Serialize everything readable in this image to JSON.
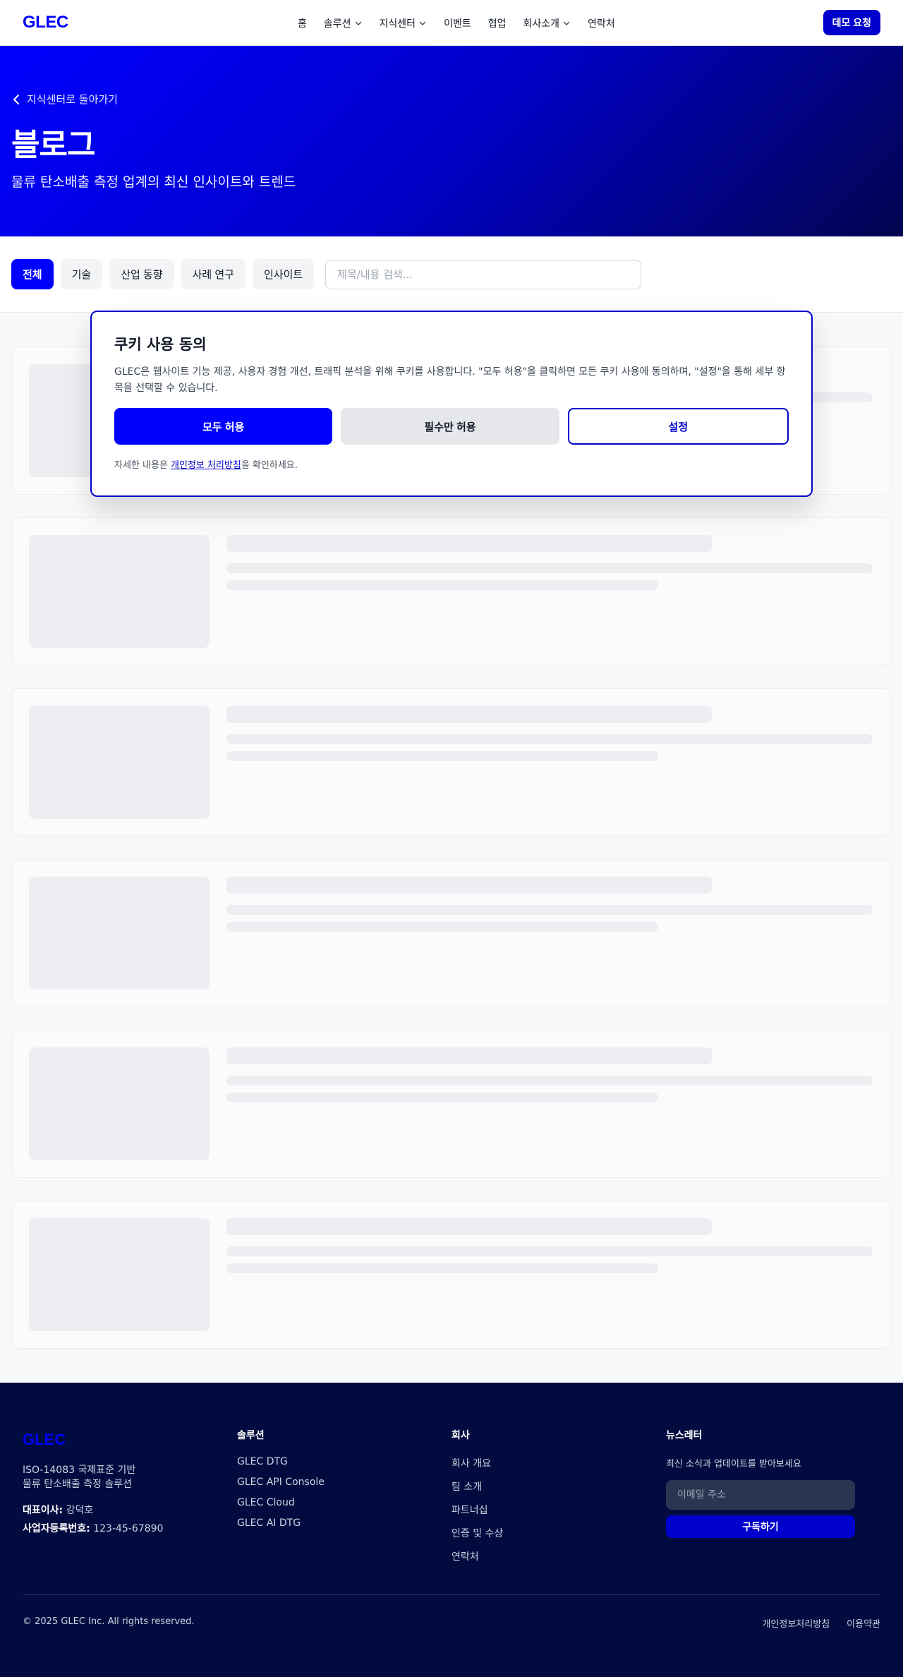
{
  "header": {
    "logo": "GLEC",
    "nav": [
      {
        "label": "홈",
        "dropdown": false
      },
      {
        "label": "솔루션",
        "dropdown": true
      },
      {
        "label": "지식센터",
        "dropdown": true
      },
      {
        "label": "이벤트",
        "dropdown": false
      },
      {
        "label": "협업",
        "dropdown": false
      },
      {
        "label": "회사소개",
        "dropdown": true
      },
      {
        "label": "연락처",
        "dropdown": false
      }
    ],
    "demo_button": "데모 요청"
  },
  "hero": {
    "back_link": "지식센터로 돌아가기",
    "title": "블로그",
    "subtitle": "물류 탄소배출 측정 업계의 최신 인사이트와 트렌드"
  },
  "filters": {
    "chips": [
      "전체",
      "기술",
      "산업 동향",
      "사례 연구",
      "인사이트"
    ],
    "active": "전체",
    "search_placeholder": "제목/내용 검색..."
  },
  "cookie": {
    "title": "쿠키 사용 동의",
    "text": "GLEC은 웹사이트 기능 제공, 사용자 경험 개선, 트래픽 분석을 위해 쿠키를 사용합니다. \"모두 허용\"을 클릭하면 모든 쿠키 사용에 동의하며, \"설정\"을 통해 세부 항목을 선택할 수 있습니다.",
    "allow_all": "모두 허용",
    "essential_only": "필수만 허용",
    "settings": "설정",
    "note_prefix": "자세한 내용은 ",
    "note_link": "개인정보 처리방침",
    "note_suffix": "을 확인하세요."
  },
  "footer": {
    "logo": "GLEC",
    "desc_line1": "ISO-14083 국제표준 기반",
    "desc_line2": "물류 탄소배출 측정 솔루션",
    "ceo_label": "대표이사:",
    "ceo_value": " 강덕호",
    "biz_label": "사업자등록번호:",
    "biz_value": " 123-45-67890",
    "solutions_head": "솔루션",
    "solutions": [
      "GLEC DTG",
      "GLEC API Console",
      "GLEC Cloud",
      "GLEC AI DTG"
    ],
    "company_head": "회사",
    "company": [
      "회사 개요",
      "팀 소개",
      "파트너십",
      "인증 및 수상",
      "연락처"
    ],
    "newsletter_head": "뉴스레터",
    "newsletter_sub": "최신 소식과 업데이트를 받아보세요",
    "email_placeholder": "이메일 주소",
    "subscribe": "구독하기",
    "copyright": "© 2025 GLEC Inc. All rights reserved.",
    "privacy": "개인정보처리방침",
    "terms": "이용약관"
  },
  "colors": {
    "brand": "#0000ff",
    "brand_dark": "#0000cc",
    "footer_bg": "#020b3f"
  }
}
